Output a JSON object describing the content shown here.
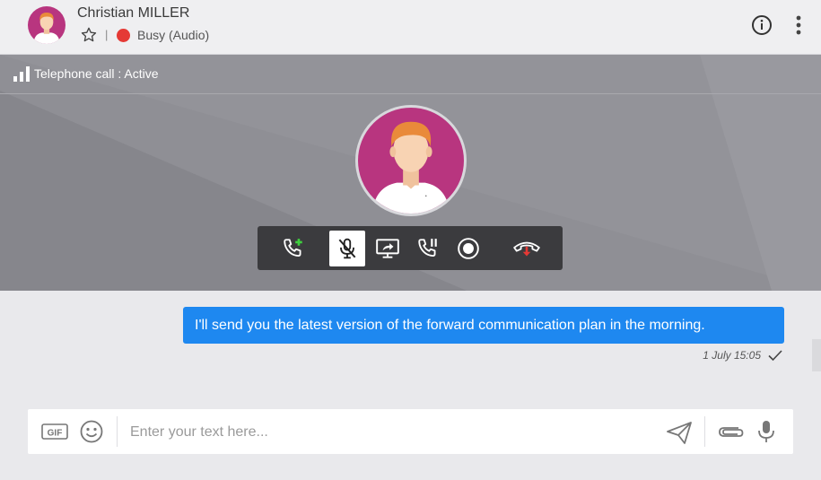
{
  "header": {
    "contact_name": "Christian MILLER",
    "separator": "|",
    "status_text": "Busy (Audio)",
    "status_color": "#e53935",
    "icons": [
      "star-icon",
      "info-icon",
      "more-vertical-icon"
    ]
  },
  "call": {
    "status": "Telephone call : Active",
    "controls": [
      {
        "name": "add-call-button",
        "icon": "phone-plus-icon"
      },
      {
        "name": "mute-button",
        "icon": "mic-off-icon",
        "active": true
      },
      {
        "name": "share-screen-button",
        "icon": "screen-share-icon"
      },
      {
        "name": "hold-call-button",
        "icon": "phone-pause-icon"
      },
      {
        "name": "record-button",
        "icon": "record-icon"
      },
      {
        "name": "hang-up-button",
        "icon": "phone-hangup-icon"
      }
    ]
  },
  "messages": [
    {
      "text": "I'll send you the latest version of the forward communication plan in the morning.",
      "time": "1 July 15:05",
      "status_icon": "check-icon"
    }
  ],
  "composer": {
    "placeholder": "Enter your text here...",
    "icons": [
      "gif-icon",
      "emoji-icon",
      "send-icon",
      "attachment-icon",
      "microphone-icon"
    ]
  },
  "colors": {
    "accent": "#1e88f0",
    "avatar_bg": "#b8357f",
    "call_panel": "#8f8f95",
    "controls_bg": "#3b3b3e",
    "add_call_green": "#3fcf3f",
    "hangup_red": "#e53935"
  }
}
